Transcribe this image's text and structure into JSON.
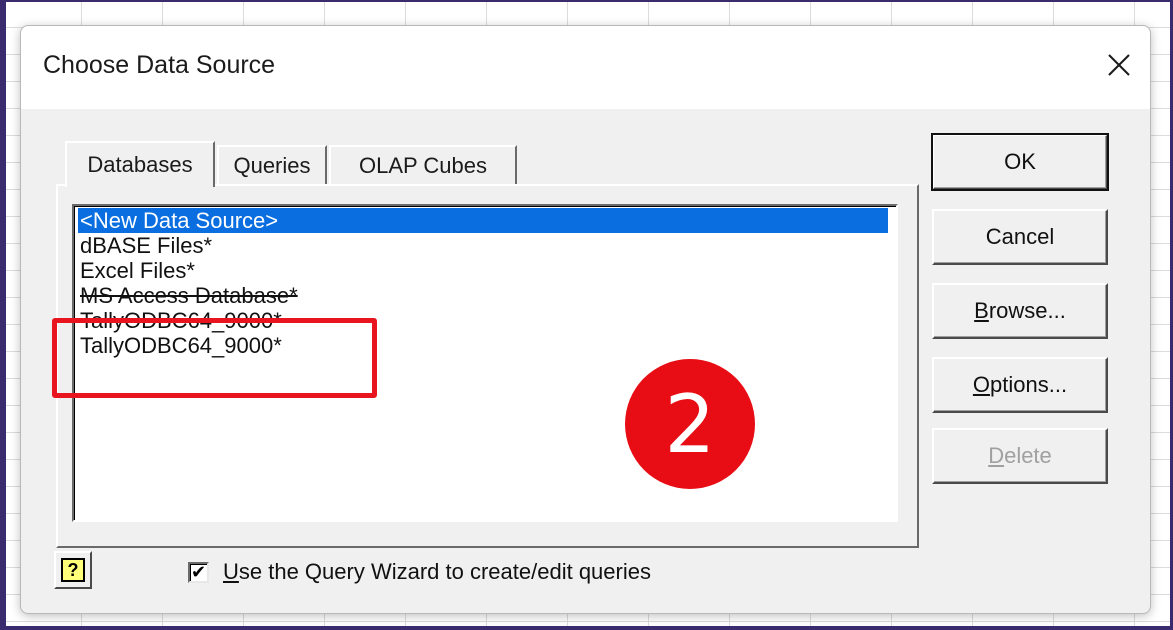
{
  "dialog": {
    "title": "Choose Data Source",
    "close_glyph": "✕"
  },
  "tabs": [
    {
      "label": "Databases",
      "active": true
    },
    {
      "label": "Queries",
      "active": false
    },
    {
      "label": "OLAP Cubes",
      "active": false
    }
  ],
  "list": {
    "items": [
      {
        "label": "<New Data Source>",
        "selected": true
      },
      {
        "label": "dBASE Files*",
        "selected": false
      },
      {
        "label": "Excel Files*",
        "selected": false
      },
      {
        "label": "MS Access Database*",
        "selected": false
      },
      {
        "label": "TallyODBC64_9000*",
        "selected": false
      },
      {
        "label": "TallyODBC64_9000*",
        "selected": false
      }
    ]
  },
  "annotation": {
    "step_number": "2",
    "highlight_color": "#e8141e"
  },
  "buttons": {
    "ok": "OK",
    "cancel": "Cancel",
    "browse": {
      "mnemonic": "B",
      "rest": "rowse..."
    },
    "options": {
      "mnemonic": "O",
      "rest": "ptions..."
    },
    "delete": {
      "mnemonic": "D",
      "rest": "elete"
    }
  },
  "footer": {
    "help_glyph": "?",
    "checkbox_checked": true,
    "checkbox_glyph": "✔",
    "checkbox_label": {
      "mnemonic": "U",
      "rest": "se the Query Wizard to create/edit queries"
    }
  },
  "colors": {
    "selection": "#0a6ee0",
    "badge": "#e80d14"
  }
}
